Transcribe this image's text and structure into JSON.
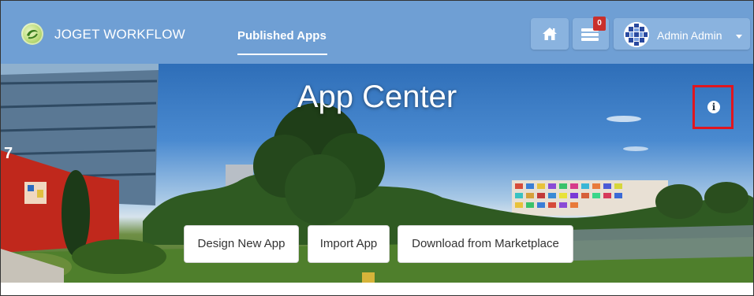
{
  "navbar": {
    "brand": "JOGET WORKFLOW",
    "nav_link": "Published Apps",
    "task_count": "0",
    "user_name": "Admin Admin",
    "icons": {
      "logo": "joget-logo-icon",
      "home": "home-icon",
      "tasks": "inbox-tray-icon",
      "avatar": "user-avatar-icon",
      "caret": "caret-down-icon"
    }
  },
  "hero": {
    "title": "App Center",
    "info_icon": "info-circle-icon",
    "buttons": {
      "design_new_app": "Design New App",
      "import_app": "Import App",
      "download_marketplace": "Download from Marketplace"
    }
  },
  "colors": {
    "navbar_bg": "#6f9fd4",
    "nav_button_bg": "#8ab3df",
    "badge": "#c9302c",
    "highlight_border": "#e0161f"
  }
}
